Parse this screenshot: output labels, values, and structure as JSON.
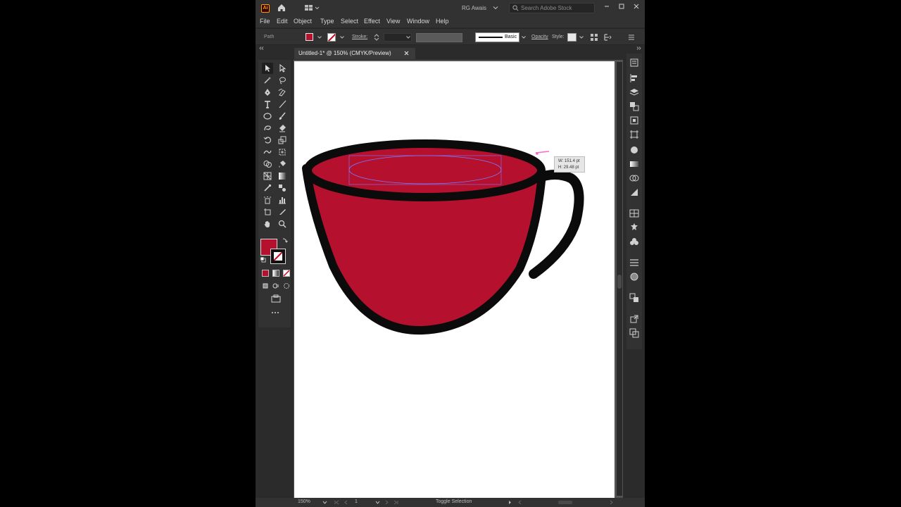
{
  "app": {
    "logo_text": "Ai",
    "workspace_user": "RG Awais"
  },
  "search": {
    "placeholder": "Search Adobe Stock"
  },
  "menu": {
    "items": [
      "File",
      "Edit",
      "Object",
      "Type",
      "Select",
      "Effect",
      "View",
      "Window",
      "Help"
    ]
  },
  "control_bar": {
    "selection_type": "Path",
    "fill_color": "#b5102e",
    "stroke_label": "Stroke:",
    "brush_label": "Basic",
    "opacity_label": "Opacity",
    "styles_label": "Style:"
  },
  "document": {
    "tab_title": "Untitled-1* @ 150% (CMYK/Preview)"
  },
  "measure_tooltip": {
    "width": "W: 151.4 pt",
    "height": "H: 29.48 pt"
  },
  "status_bar": {
    "zoom": "150%",
    "artboard": "1",
    "status": "Toggle Selection"
  },
  "colors": {
    "cup_fill": "#b5102e",
    "cup_stroke": "#0b0b0b",
    "selection": "#7b7bff",
    "ui_bg": "#2b2b2b"
  }
}
